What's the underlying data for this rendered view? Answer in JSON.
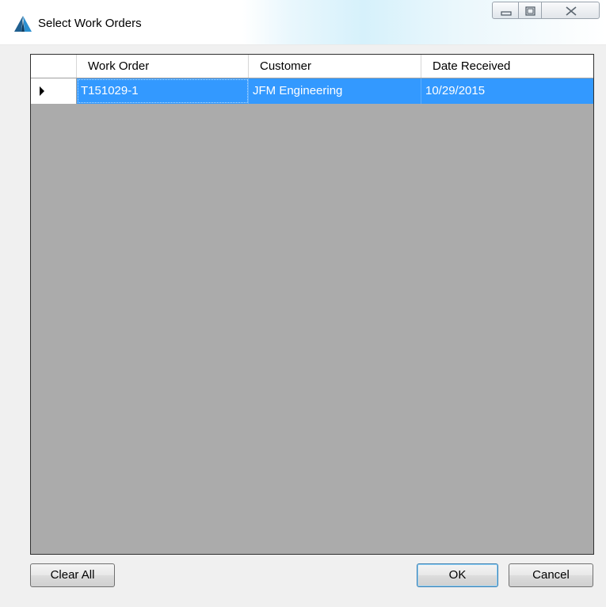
{
  "window": {
    "title": "Select Work Orders"
  },
  "grid": {
    "columns": [
      "Work Order",
      "Customer",
      "Date Received"
    ],
    "rows": [
      {
        "work_order": "T151029-1",
        "customer": "JFM Engineering",
        "date_received": "10/29/2015",
        "selected": true
      }
    ]
  },
  "buttons": {
    "clear_all": "Clear All",
    "ok": "OK",
    "cancel": "Cancel"
  },
  "colors": {
    "selection": "#3399ff",
    "grid_background": "#ababab"
  },
  "icons": {
    "app": "app-logo-icon",
    "minimize": "minimize-icon",
    "maximize": "maximize-icon",
    "close": "close-icon",
    "row_indicator": "row-indicator-arrow-icon"
  }
}
